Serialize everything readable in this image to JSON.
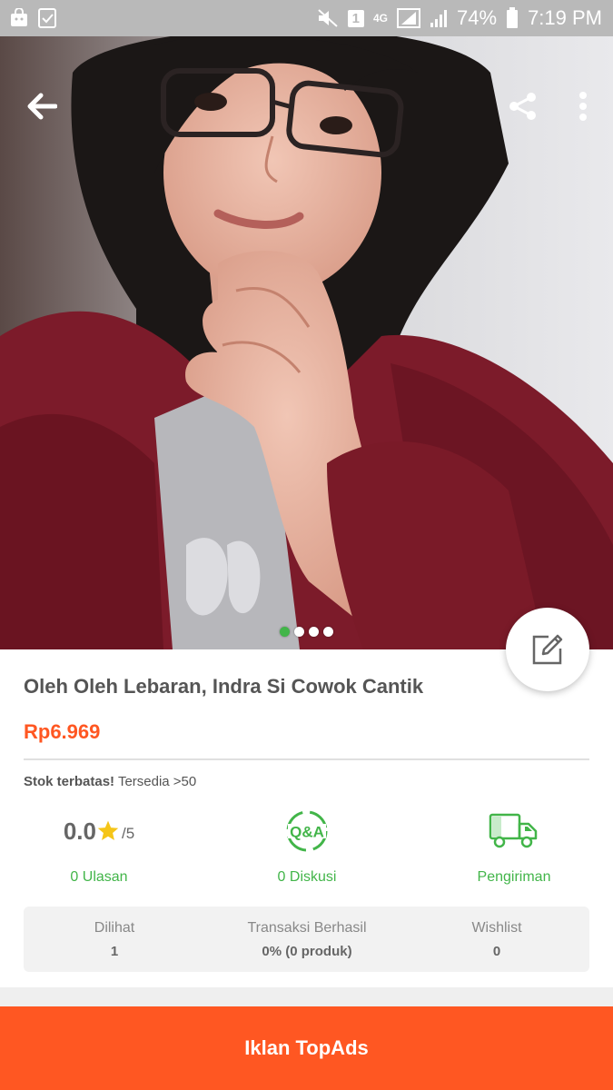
{
  "status_bar": {
    "battery": "74%",
    "time": "7:19 PM",
    "sim_badge": "1",
    "network": "4G"
  },
  "hero": {
    "slides_total": 4,
    "active_slide": 1
  },
  "product": {
    "title": "Oleh Oleh Lebaran, Indra Si Cowok Cantik",
    "price": "Rp6.969",
    "stock_bold": "Stok terbatas!",
    "stock_rest": "Tersedia >50"
  },
  "stats": {
    "rating_value": "0.0",
    "rating_max": "/5",
    "reviews_label": "0 Ulasan",
    "qa_icon_text": "Q&A",
    "discussion_label": "0 Diskusi",
    "shipping_label": "Pengiriman"
  },
  "counters": [
    {
      "label": "Dilihat",
      "value": "1"
    },
    {
      "label": "Transaksi Berhasil",
      "value": "0% (0 produk)"
    },
    {
      "label": "Wishlist",
      "value": "0"
    }
  ],
  "cta": {
    "label": "Iklan TopAds"
  },
  "colors": {
    "primary_orange": "#ff5722",
    "accent_green": "#42b549",
    "star_yellow": "#f5c518"
  }
}
